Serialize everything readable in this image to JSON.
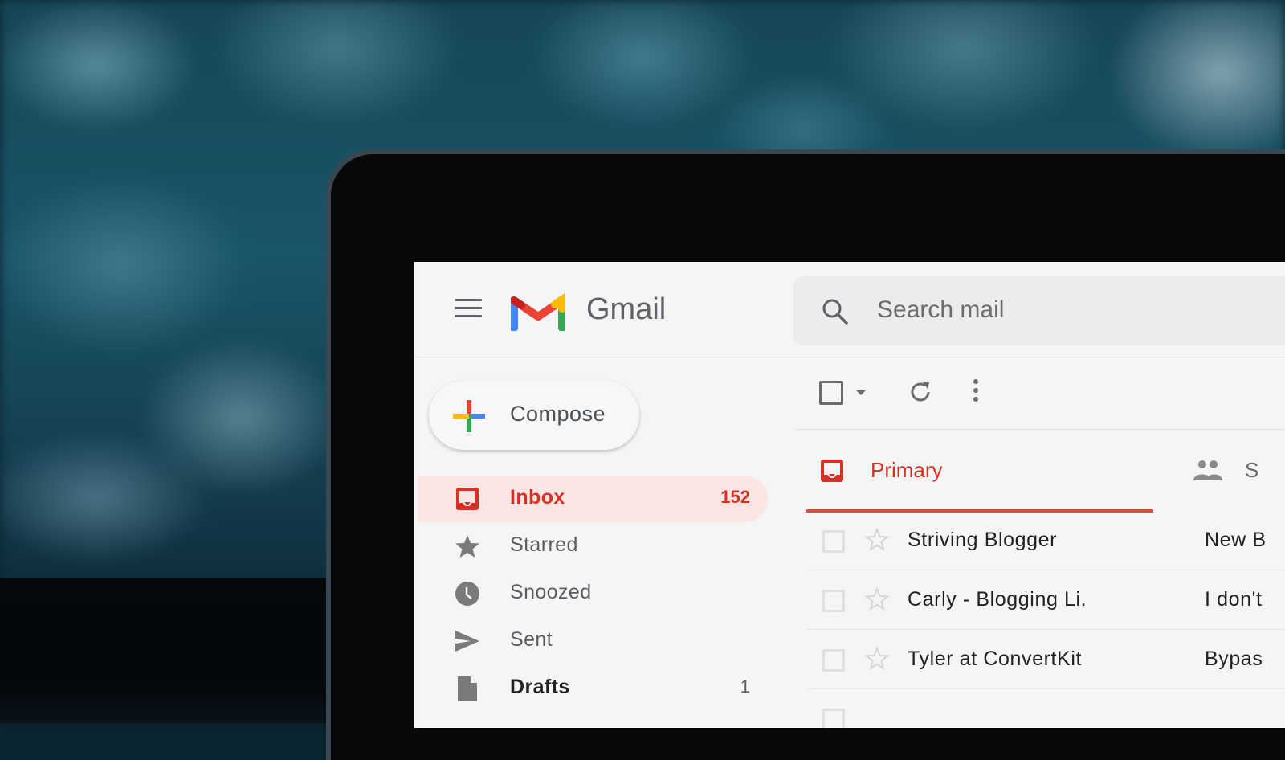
{
  "app": {
    "name": "Gmail",
    "brand_colors": {
      "red": "#EA4335",
      "blue": "#4285F4",
      "yellow": "#FBBC04",
      "green": "#34A853"
    },
    "accent": "#D93025"
  },
  "header": {
    "menu_icon": "hamburger-menu-icon",
    "logo_icon": "gmail-m-logo",
    "logo_text": "Gmail",
    "search": {
      "icon": "search-icon",
      "placeholder": "Search mail",
      "value": ""
    }
  },
  "sidebar": {
    "compose": {
      "icon": "multicolor-plus-icon",
      "label": "Compose"
    },
    "items": [
      {
        "icon": "inbox-icon",
        "label": "Inbox",
        "count": "152",
        "active": true
      },
      {
        "icon": "star-icon",
        "label": "Starred",
        "count": ""
      },
      {
        "icon": "clock-icon",
        "label": "Snoozed",
        "count": ""
      },
      {
        "icon": "send-icon",
        "label": "Sent",
        "count": ""
      },
      {
        "icon": "draft-file-icon",
        "label": "Drafts",
        "count": "1"
      }
    ]
  },
  "toolbar": {
    "select_all_icon": "checkbox-icon",
    "select_menu_icon": "caret-down-icon",
    "refresh_icon": "refresh-icon",
    "more_icon": "more-vertical-icon"
  },
  "tabs": [
    {
      "icon": "inbox-icon",
      "label": "Primary",
      "active": true
    },
    {
      "icon": "people-icon",
      "label": "Social",
      "visible_label": "S"
    }
  ],
  "emails": [
    {
      "sender": "Striving Blogger",
      "subject_visible": "New B"
    },
    {
      "sender": "Carly - Blogging Li.",
      "subject_visible": "I don't"
    },
    {
      "sender": "Tyler at ConvertKit",
      "subject_visible": "Bypas"
    }
  ]
}
